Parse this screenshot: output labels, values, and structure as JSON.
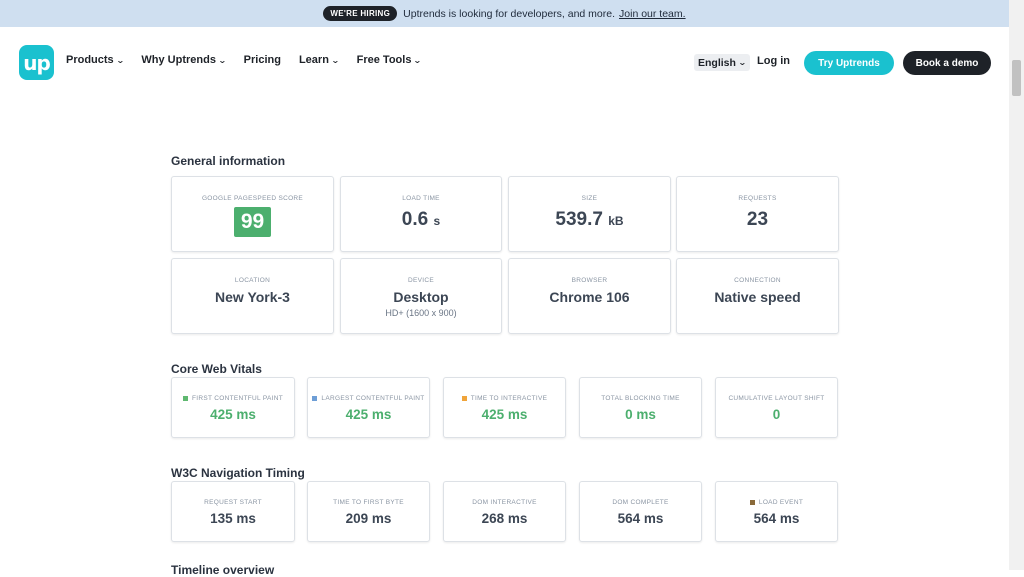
{
  "banner": {
    "badge": "WE'RE HIRING",
    "text": "Uptrends is looking for developers, and more.",
    "link": "Join our team."
  },
  "nav": {
    "logo_text": "up",
    "items": [
      "Products",
      "Why Uptrends",
      "Pricing",
      "Learn",
      "Free Tools"
    ],
    "language": "English",
    "login": "Log in",
    "try_button": "Try Uptrends",
    "demo_button": "Book a demo"
  },
  "general": {
    "title": "General information",
    "score_label": "GOOGLE PAGESPEED SCORE",
    "score_value": "99",
    "load_label": "LOAD TIME",
    "load_value": "0.6",
    "load_unit": "s",
    "size_label": "SIZE",
    "size_value": "539.7",
    "size_unit": "kB",
    "requests_label": "REQUESTS",
    "requests_value": "23",
    "location_label": "LOCATION",
    "location_value": "New York-3",
    "device_label": "DEVICE",
    "device_value": "Desktop",
    "device_sub": "HD+ (1600 x 900)",
    "browser_label": "BROWSER",
    "browser_value": "Chrome 106",
    "connection_label": "CONNECTION",
    "connection_value": "Native speed"
  },
  "vitals": {
    "title": "Core Web Vitals",
    "items": [
      {
        "label": "FIRST CONTENTFUL PAINT",
        "value": "425 ms",
        "marker": "#5fb870"
      },
      {
        "label": "LARGEST CONTENTFUL PAINT",
        "value": "425 ms",
        "marker": "#6e9ed6"
      },
      {
        "label": "TIME TO INTERACTIVE",
        "value": "425 ms",
        "marker": "#f0a43a"
      },
      {
        "label": "TOTAL BLOCKING TIME",
        "value": "0 ms"
      },
      {
        "label": "CUMULATIVE LAYOUT SHIFT",
        "value": "0"
      }
    ],
    "value_color": "#4caf6e"
  },
  "w3c": {
    "title": "W3C Navigation Timing",
    "items": [
      {
        "label": "REQUEST START",
        "value": "135 ms"
      },
      {
        "label": "TIME TO FIRST BYTE",
        "value": "209 ms"
      },
      {
        "label": "DOM INTERACTIVE",
        "value": "268 ms"
      },
      {
        "label": "DOM COMPLETE",
        "value": "564 ms"
      },
      {
        "label": "LOAD EVENT",
        "value": "564 ms",
        "marker": "#8a6a3a"
      }
    ]
  },
  "next_section_partial": "Timeline overview"
}
